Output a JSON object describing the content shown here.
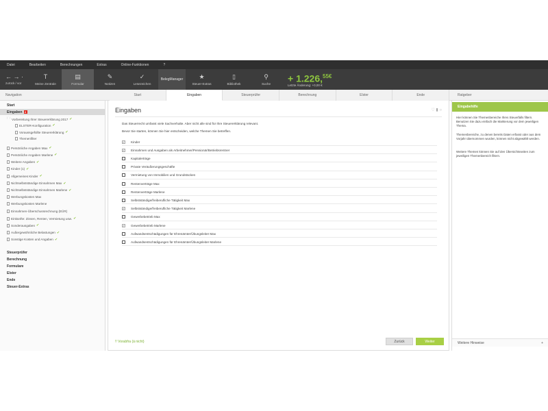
{
  "menu": [
    "Datei",
    "Bearbeiten",
    "Berechnungen",
    "Extras",
    "Online-Funktionen",
    "?"
  ],
  "toolbar": {
    "nav_arrows": "← → ·",
    "nav_label": "zurück / vor",
    "buttons": [
      {
        "icon": "T",
        "label": "Meine Zentrale",
        "icon_name": "home-t-icon"
      },
      {
        "icon": "▤",
        "label": "Formular",
        "icon_name": "form-icon"
      },
      {
        "icon": "✎",
        "label": "Notizen",
        "icon_name": "pencil-icon"
      },
      {
        "icon": "✓",
        "label": "Lesezeichen",
        "icon_name": "bookmark-check-icon"
      }
    ],
    "beleg_label": "BelegManager",
    "buttons2": [
      {
        "icon": "★",
        "label": "Steuer-Extras",
        "icon_name": "star-icon"
      },
      {
        "icon": "▯",
        "label": "Bibliothek",
        "icon_name": "book-icon"
      },
      {
        "icon": "⚲",
        "label": "Suche",
        "icon_name": "search-icon"
      }
    ],
    "refund_prefix": "+ 1.226,",
    "refund_cents": "55€",
    "refund_sub": "Letzte Änderung: +0,00 €"
  },
  "strip": {
    "left": "Navigation",
    "tabs": [
      "Start",
      "Eingaben",
      "Steuerprüfer",
      "Berechnung",
      "Elster",
      "Ende"
    ],
    "active_tab": 1,
    "right": "Ratgeber"
  },
  "sidebar": {
    "start": "Start",
    "eingaben": "Eingaben",
    "eingaben_badge": "2",
    "vorbereitung": "Vorbereitung Ihrer Steuererklärung 2017",
    "sub_items": [
      "ELSTER-Konfiguration",
      "Voraussgefüllte Steuererklärung",
      "Themenfilter"
    ],
    "items": [
      "Persönliche Angaben Max",
      "Persönliche Angaben Marlene",
      "Weitere Angaben",
      "Kinder (1)",
      "Allgemeines Kinder",
      "Nichtselbstständige Einnahmen Max",
      "Nichtselbstständige Einnahmen Marlene",
      "Werbungskosten Max",
      "Werbungskosten Marlene",
      "Einnahmen-Überschussrechnung (EÜR)",
      "Einkünfte: Zinsen, Renten, Vermietung usw.",
      "Sonderausgaben",
      "Außergewöhnliche Belastungen",
      "Sonstige Kosten und Angaben"
    ],
    "checked_items": [
      0,
      1,
      2,
      3,
      4,
      5,
      6,
      10,
      11,
      12,
      13
    ],
    "bottom": [
      "Steuerprüfer",
      "Berechnung",
      "Formulare",
      "Elster",
      "Ende",
      "Steuer-Extras"
    ]
  },
  "main": {
    "title": "Eingaben",
    "intro1": "Das Steuerrecht umfasst viele Sachverhalte. Aber nicht alle sind für Ihre Steuererklärung relevant.",
    "intro2": "Bevor Sie starten, können Sie hier entscheiden, welche Themen Sie betreffen.",
    "options": [
      {
        "label": "Kinder",
        "checked": true
      },
      {
        "label": "Einnahmen und Ausgaben als Arbeitnehmer/Pensionär/Betriebsrentner",
        "checked": true
      },
      {
        "label": "Kapitalerträge",
        "checked": false
      },
      {
        "label": "Private Veräußerungsgeschäfte",
        "checked": false
      },
      {
        "label": "Vermietung von Immobilien und Grundstücken",
        "checked": false
      },
      {
        "label": "Rentenverträge Max",
        "checked": false
      },
      {
        "label": "Rentenverträge Marlene",
        "checked": false
      },
      {
        "label": "Selbstständige/freiberufliche Tätigkeit Max",
        "checked": false
      },
      {
        "label": "Selbstständige/freiberufliche Tätigkeit Marlene",
        "checked": true
      },
      {
        "label": "Gewerbebetrieb Max",
        "checked": false
      },
      {
        "label": "Gewerbebetrieb Marlene",
        "checked": true
      },
      {
        "label": "Aufwandsentschädigungen für Ehrenämter/Übungsleiter Max",
        "checked": false
      },
      {
        "label": "Aufwandsentschädigungen für Ehrenämter/Übungsleiter Marlene",
        "checked": false
      }
    ],
    "prev_link": "!! Vorabfra (ä nicht)",
    "back_button": "Zurück",
    "next_button": "Weiter"
  },
  "help": {
    "header": "Eingabehilfe",
    "p1": "Hier können Sie Themenbereiche Ihres Steuerfalls filtern. Benutzen Sie dazu einfach die Markierung vor dem jeweiligen Thema.",
    "p2": "Themenbereiche, zu denen bereits Daten erfasst oder aus dem Vorjahr übernommen wurden, können nicht abgewählt werden.",
    "p3": "Weitere Themen können Sie auf den Übersichtsseiten zum jeweiligen Themenbereich filtern.",
    "footer": "Weitere Hinweise",
    "footer_icon": "+"
  },
  "colors": {
    "accent_green": "#8ec63f",
    "help_header": "#9ec64a",
    "badge_red": "#e2231a",
    "toolbar": "#3c3c3c"
  }
}
